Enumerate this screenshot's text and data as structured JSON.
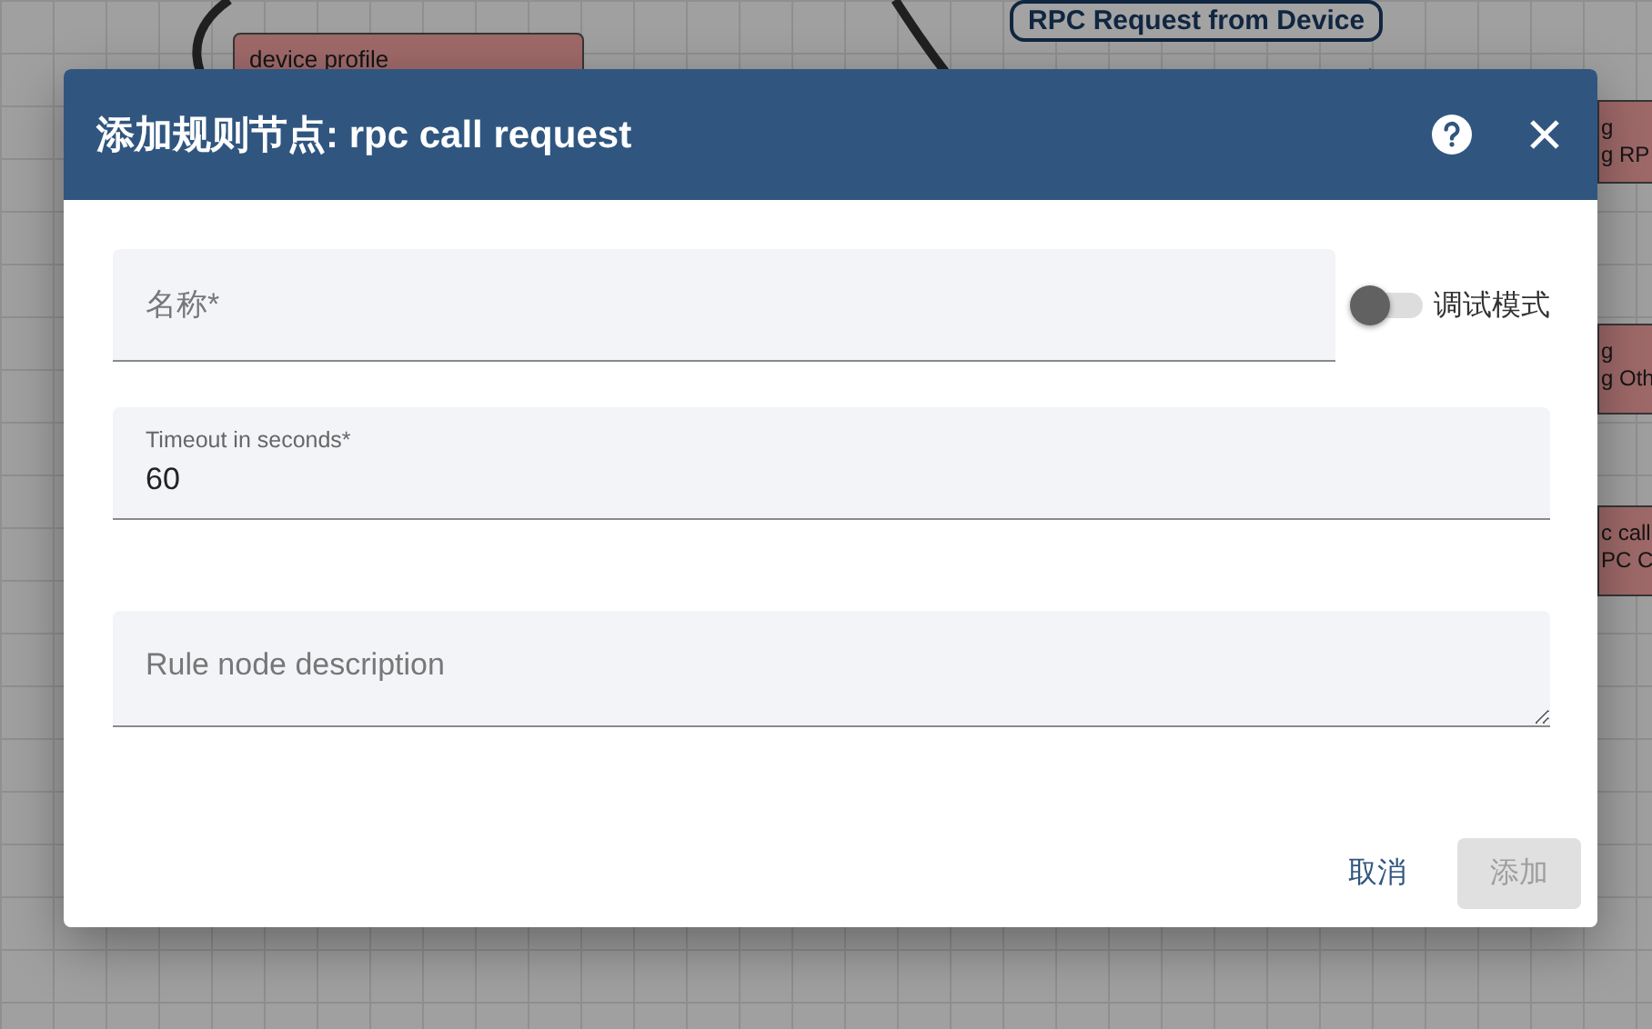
{
  "canvas": {
    "nodes": [
      {
        "lines": [
          "device profile"
        ]
      },
      {
        "lines": [
          "g",
          "g RP"
        ]
      },
      {
        "lines": [
          "g",
          "g Oth"
        ]
      },
      {
        "lines": [
          "c call",
          "PC C"
        ]
      }
    ],
    "edge_labels": [
      "RPC Request from Device"
    ]
  },
  "dialog": {
    "title": "添加规则节点: rpc call request",
    "fields": [
      {
        "kind": "text",
        "placeholder": "名称*"
      },
      {
        "kind": "labeled",
        "label": "Timeout in seconds*",
        "value": "60"
      },
      {
        "kind": "textarea",
        "placeholder": "Rule node description"
      }
    ],
    "debug_toggle": {
      "label": "调试模式",
      "on": false
    },
    "buttons": [
      {
        "label": "取消",
        "kind": "text",
        "disabled": false
      },
      {
        "label": "添加",
        "kind": "raised",
        "disabled": true
      }
    ]
  }
}
